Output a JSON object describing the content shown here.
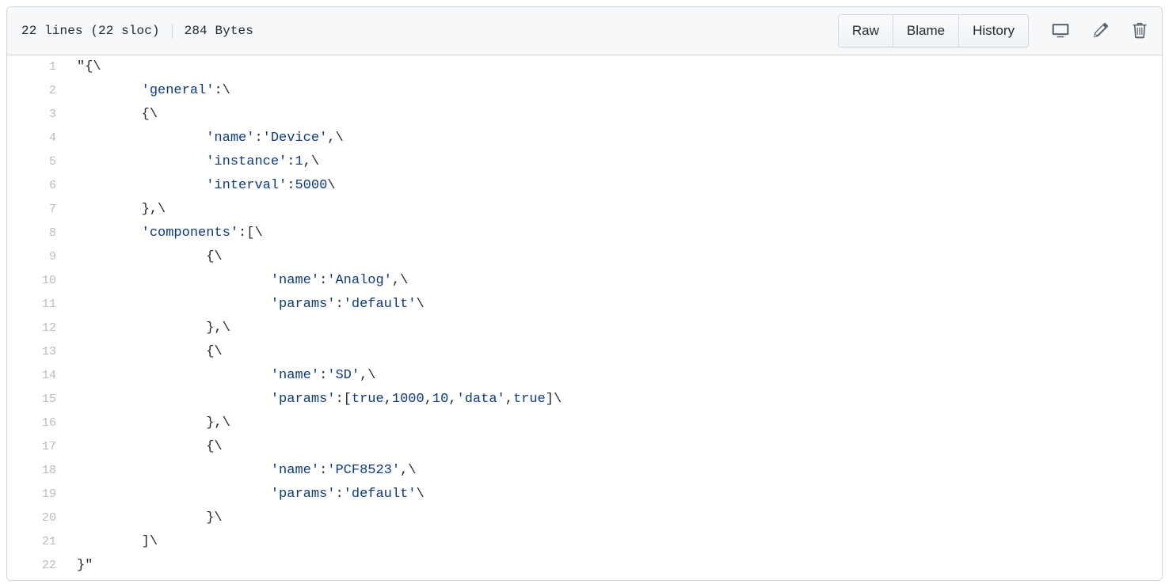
{
  "header": {
    "lines_label": "22 lines (22 sloc)",
    "size_label": "284 Bytes",
    "buttons": [
      {
        "name": "raw",
        "label": "Raw"
      },
      {
        "name": "blame",
        "label": "Blame"
      },
      {
        "name": "history",
        "label": "History"
      }
    ],
    "icons": [
      {
        "name": "desktop-icon",
        "title": "Open this file in GitHub Desktop"
      },
      {
        "name": "pencil-icon",
        "title": "Edit this file"
      },
      {
        "name": "trash-icon",
        "title": "Delete this file"
      }
    ]
  },
  "colors": {
    "header_bg": "#f6f8fa",
    "border": "#d1d5da",
    "code_text": "#24292e",
    "string_blue": "#0d3a7d",
    "line_number": "#babbbd"
  },
  "code": {
    "language": "json-string",
    "line_count": 22,
    "tab_size": 8,
    "lines": [
      {
        "n": 1,
        "text": "\"{\\"
      },
      {
        "n": 2,
        "text": "\t'general':\\"
      },
      {
        "n": 3,
        "text": "\t{\\"
      },
      {
        "n": 4,
        "text": "\t\t'name':'Device',\\"
      },
      {
        "n": 5,
        "text": "\t\t'instance':1,\\"
      },
      {
        "n": 6,
        "text": "\t\t'interval':5000\\"
      },
      {
        "n": 7,
        "text": "\t},\\"
      },
      {
        "n": 8,
        "text": "\t'components':[\\"
      },
      {
        "n": 9,
        "text": "\t\t{\\"
      },
      {
        "n": 10,
        "text": "\t\t\t'name':'Analog',\\"
      },
      {
        "n": 11,
        "text": "\t\t\t'params':'default'\\"
      },
      {
        "n": 12,
        "text": "\t\t},\\"
      },
      {
        "n": 13,
        "text": "\t\t{\\"
      },
      {
        "n": 14,
        "text": "\t\t\t'name':'SD',\\"
      },
      {
        "n": 15,
        "text": "\t\t\t'params':[true,1000,10,'data',true]\\"
      },
      {
        "n": 16,
        "text": "\t\t},\\"
      },
      {
        "n": 17,
        "text": "\t\t{\\"
      },
      {
        "n": 18,
        "text": "\t\t\t'name':'PCF8523',\\"
      },
      {
        "n": 19,
        "text": "\t\t\t'params':'default'\\"
      },
      {
        "n": 20,
        "text": "\t\t}\\"
      },
      {
        "n": 21,
        "text": "\t]\\"
      },
      {
        "n": 22,
        "text": "}\""
      }
    ]
  }
}
